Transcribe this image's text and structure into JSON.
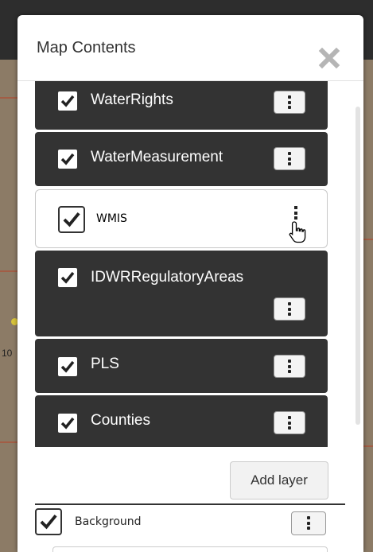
{
  "panel": {
    "title": "Map Contents"
  },
  "layers": [
    {
      "label": "WaterRights",
      "checked": true,
      "style": "dark"
    },
    {
      "label": "WaterMeasurement",
      "checked": true,
      "style": "dark"
    },
    {
      "label": "WMIS",
      "checked": true,
      "style": "light"
    },
    {
      "label": "IDWRRegulatoryAreas",
      "checked": true,
      "style": "dark"
    },
    {
      "label": "PLS",
      "checked": true,
      "style": "dark"
    },
    {
      "label": "Counties",
      "checked": true,
      "style": "dark"
    }
  ],
  "add_layer_label": "Add layer",
  "background": {
    "label": "Background",
    "checked": true
  },
  "map_edge_text": "10",
  "colors": {
    "layer_dark": "#333333",
    "map_lines": "#b0492e"
  }
}
